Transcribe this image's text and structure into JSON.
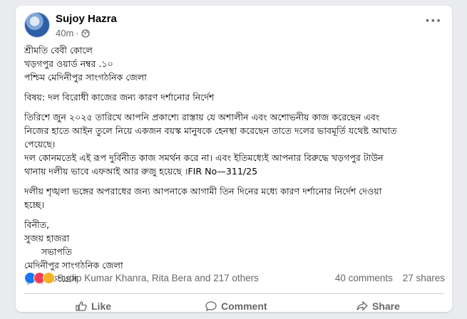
{
  "post": {
    "author": "Sujoy Hazra",
    "time": "40m",
    "privacy_icon": "globe-icon",
    "more_icon": "more-horizontal-icon"
  },
  "content": {
    "address": [
      "শ্রীমতি বেবী কোলে",
      "খড়গপুর ওয়ার্ড নম্বর .১০",
      "পশ্চিম মেদিনীপুর সাংগঠনিক জেলা"
    ],
    "subject": "বিষয়: দল বিরোধী কাজের জন্য কারণ দর্শানোর নির্দেশ",
    "paragraph1": [
      "তিরিশে জুন ২০২৫ তারিখে আপনি প্রকাশ্যে রাস্তায় যে অশালীন এবং অশোভনীয় কাজ করেছেন এবং",
      "নিজের হাতে আইন তুলে নিয়ে একজন বয়স্ক মানুষকে হেনস্থা করেছেন তাতে দলের ভাবমূর্তি যথেষ্ট আঘাত",
      "পেয়েছে।",
      "দল কোনমতেই এই রূপ দুর্বিনীত কাজ সমর্থন করে না। এবং ইতিমধ্যেই আপনার বিরুদ্ধে খড়গপুর টাউন",
      "থানায় দলীয় ভাবে এফআই আর রুজু হয়েছে ।FIR No—311/25"
    ],
    "paragraph2": [
      "দলীয় শৃঙ্খলা ভঙ্গের অপরাধের জন্য আপনাকে আগামী তিন দিনের মধ্যে কারণ দর্শানোর নির্দেশ দেওয়া",
      "হচ্ছে।"
    ],
    "signature": [
      "বিনীত,",
      "সুজয় হাজরা",
      "      সভাপতি",
      "মেদিনীপুর সাংগঠনিক জেলা",
      "তৃণমূল কংগ্রেস"
    ]
  },
  "stats": {
    "reactors": "Sudip Kumar Khanra, Rita Bera and 217 others",
    "comments": "40 comments",
    "shares": "27 shares",
    "reaction_colors": {
      "like": "#1877f2",
      "love": "#f33e58",
      "care": "#f7b125"
    }
  },
  "actions": {
    "like": "Like",
    "comment": "Comment",
    "share": "Share"
  }
}
